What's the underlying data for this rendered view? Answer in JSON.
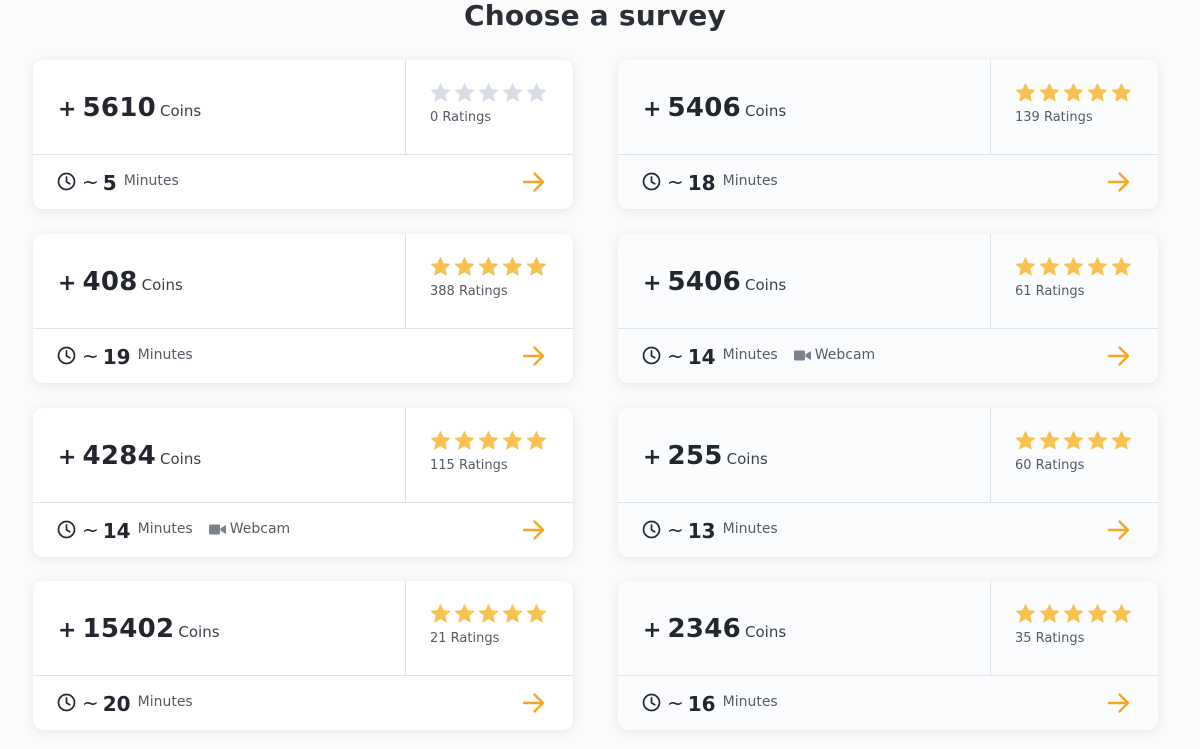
{
  "page": {
    "title": "Choose a survey",
    "accent_color": "#f5a623",
    "star_filled_color": "#f9c14f",
    "star_empty_color": "#d8dde6"
  },
  "surveys": [
    {
      "plus": "+",
      "coins": "5610",
      "coins_label": "Coins",
      "rating_stars": 0,
      "ratings": "0 Ratings",
      "tilde": "~",
      "minutes": "5",
      "minutes_label": "Minutes",
      "webcam": ""
    },
    {
      "plus": "+",
      "coins": "5406",
      "coins_label": "Coins",
      "rating_stars": 5,
      "ratings": "139 Ratings",
      "tilde": "~",
      "minutes": "18",
      "minutes_label": "Minutes",
      "webcam": ""
    },
    {
      "plus": "+",
      "coins": "408",
      "coins_label": "Coins",
      "rating_stars": 5,
      "ratings": "388 Ratings",
      "tilde": "~",
      "minutes": "19",
      "minutes_label": "Minutes",
      "webcam": ""
    },
    {
      "plus": "+",
      "coins": "5406",
      "coins_label": "Coins",
      "rating_stars": 5,
      "ratings": "61 Ratings",
      "tilde": "~",
      "minutes": "14",
      "minutes_label": "Minutes",
      "webcam": "Webcam"
    },
    {
      "plus": "+",
      "coins": "4284",
      "coins_label": "Coins",
      "rating_stars": 5,
      "ratings": "115 Ratings",
      "tilde": "~",
      "minutes": "14",
      "minutes_label": "Minutes",
      "webcam": "Webcam"
    },
    {
      "plus": "+",
      "coins": "255",
      "coins_label": "Coins",
      "rating_stars": 5,
      "ratings": "60 Ratings",
      "tilde": "~",
      "minutes": "13",
      "minutes_label": "Minutes",
      "webcam": ""
    },
    {
      "plus": "+",
      "coins": "15402",
      "coins_label": "Coins",
      "rating_stars": 5,
      "ratings": "21 Ratings",
      "tilde": "~",
      "minutes": "20",
      "minutes_label": "Minutes",
      "webcam": ""
    },
    {
      "plus": "+",
      "coins": "2346",
      "coins_label": "Coins",
      "rating_stars": 5,
      "ratings": "35 Ratings",
      "tilde": "~",
      "minutes": "16",
      "minutes_label": "Minutes",
      "webcam": ""
    }
  ]
}
